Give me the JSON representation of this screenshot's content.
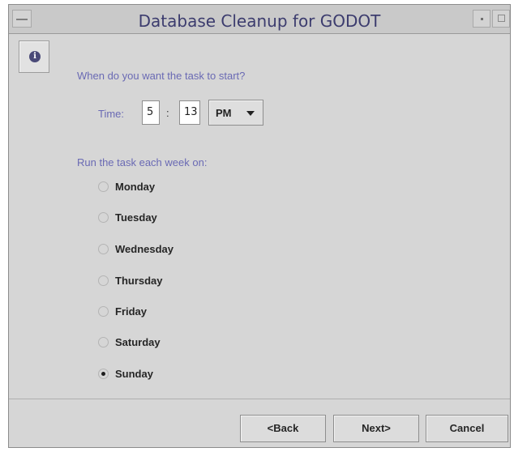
{
  "window": {
    "title": "Database Cleanup for GODOT"
  },
  "icons": {
    "info": "i"
  },
  "schedule": {
    "start_question": "When do you want the task to start?",
    "time_label": "Time:",
    "hour": "5",
    "separator": ":",
    "minute": "13",
    "ampm": "PM"
  },
  "weekly": {
    "question": "Run the task each week on:",
    "days": [
      {
        "label": "Monday",
        "selected": false
      },
      {
        "label": "Tuesday",
        "selected": false
      },
      {
        "label": "Wednesday",
        "selected": false
      },
      {
        "label": "Thursday",
        "selected": false
      },
      {
        "label": "Friday",
        "selected": false
      },
      {
        "label": "Saturday",
        "selected": false
      },
      {
        "label": "Sunday",
        "selected": true
      }
    ]
  },
  "buttons": {
    "back": "<Back",
    "next": "Next>",
    "cancel": "Cancel"
  }
}
